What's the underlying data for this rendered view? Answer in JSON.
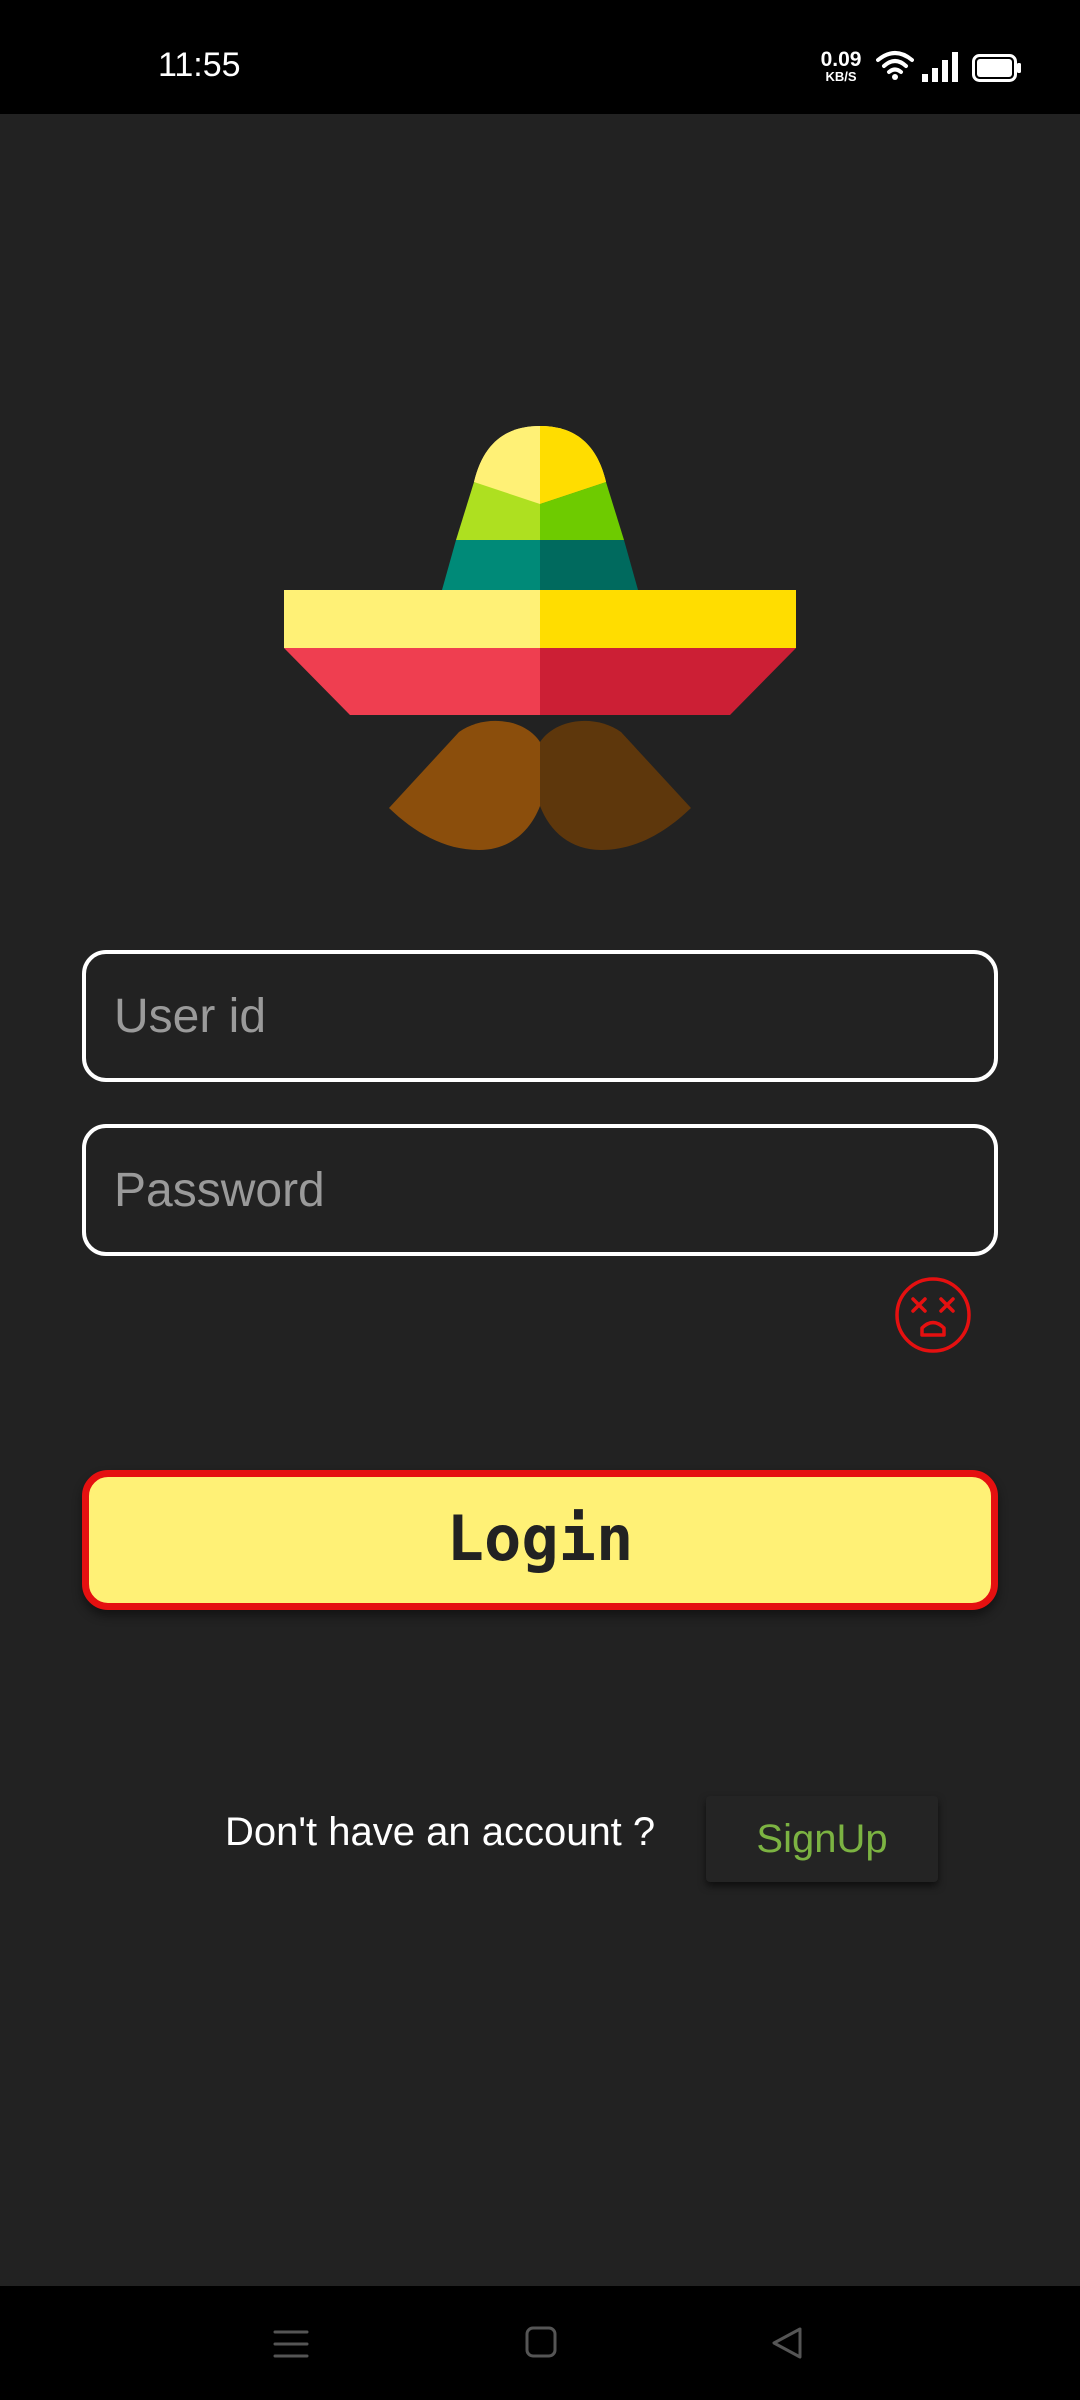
{
  "status_bar": {
    "time": "11:55",
    "speed_value": "0.09",
    "speed_unit": "KB/S"
  },
  "login_form": {
    "user_placeholder": "User id",
    "password_placeholder": "Password",
    "login_label": "Login",
    "status_icon": "dizzy-face-icon"
  },
  "signup": {
    "prompt": "Don't have an account ?",
    "button_label": "SignUp"
  },
  "colors": {
    "background": "#222222",
    "login_fill": "#fff176",
    "login_border": "#e51010",
    "signup_text": "#7cb342",
    "error_icon": "#e51010"
  },
  "nav_bar": {
    "icons": [
      "menu-icon",
      "home-icon",
      "back-icon"
    ]
  }
}
